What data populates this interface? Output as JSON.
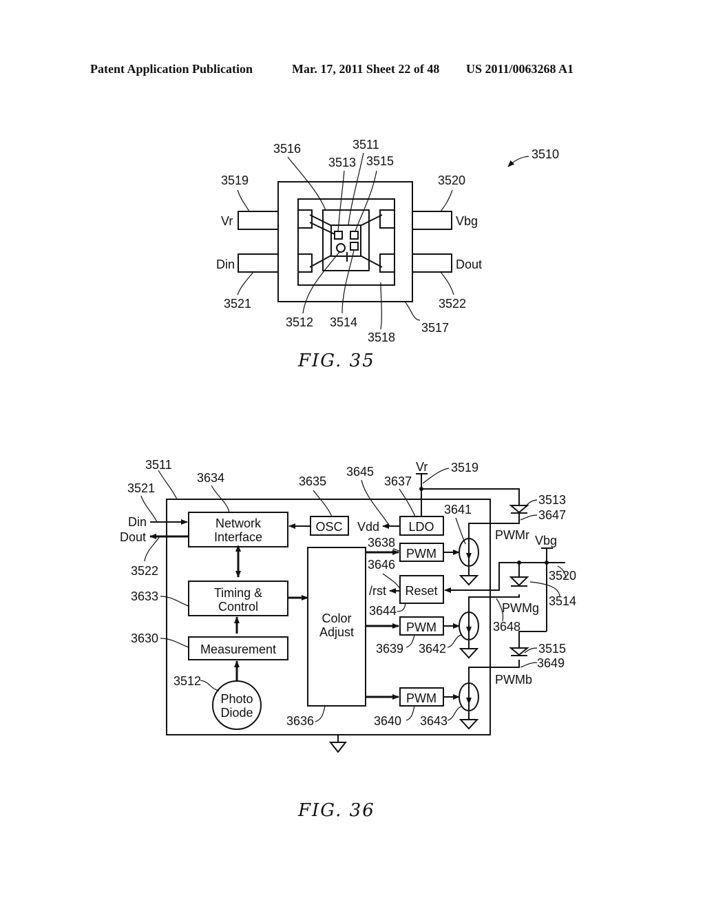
{
  "header": {
    "publication": "Patent Application Publication",
    "date_sheet": "Mar. 17, 2011  Sheet 22 of 48",
    "patent_number": "US 2011/0063268 A1"
  },
  "fig35": {
    "caption": "FIG.  35",
    "ref_package": "3510",
    "refs": {
      "r3511": "3511",
      "r3512": "3512",
      "r3513": "3513",
      "r3514": "3514",
      "r3515": "3515",
      "r3516": "3516",
      "r3517": "3517",
      "r3518": "3518",
      "r3519": "3519",
      "r3520": "3520",
      "r3521": "3521",
      "r3522": "3522"
    },
    "pins": {
      "vr": "Vr",
      "vbg": "Vbg",
      "din": "Din",
      "dout": "Dout"
    }
  },
  "fig36": {
    "caption": "FIG.  36",
    "blocks": {
      "network_interface": [
        "Network",
        "Interface"
      ],
      "timing_control": [
        "Timing &",
        "Control"
      ],
      "measurement": "Measurement",
      "photo_diode": [
        "Photo",
        "Diode"
      ],
      "osc": "OSC",
      "ldo": "LDO",
      "color_adjust": [
        "Color",
        "Adjust"
      ],
      "pwm_r": "PWM",
      "pwm_g": "PWM",
      "pwm_b": "PWM",
      "reset": "Reset"
    },
    "signals": {
      "din": "Din",
      "dout": "Dout",
      "vdd": "Vdd",
      "rst": "/rst",
      "vr": "Vr",
      "vbg": "Vbg",
      "pwmr": "PWMr",
      "pwmg": "PWMg",
      "pwmb": "PWMb"
    },
    "refs": {
      "r3511": "3511",
      "r3521": "3521",
      "r3522": "3522",
      "r3634": "3634",
      "r3635": "3635",
      "r3645": "3645",
      "r3637": "3637",
      "r3519": "3519",
      "r3513": "3513",
      "r3647": "3647",
      "r3641": "3641",
      "r3638": "3638",
      "r3646": "3646",
      "r3644": "3644",
      "r3633": "3633",
      "r3630": "3630",
      "r3512": "3512",
      "r3636": "3636",
      "r3639": "3639",
      "r3642": "3642",
      "r3640": "3640",
      "r3643": "3643",
      "r3520": "3520",
      "r3514": "3514",
      "r3648": "3648",
      "r3515": "3515",
      "r3649": "3649"
    }
  }
}
